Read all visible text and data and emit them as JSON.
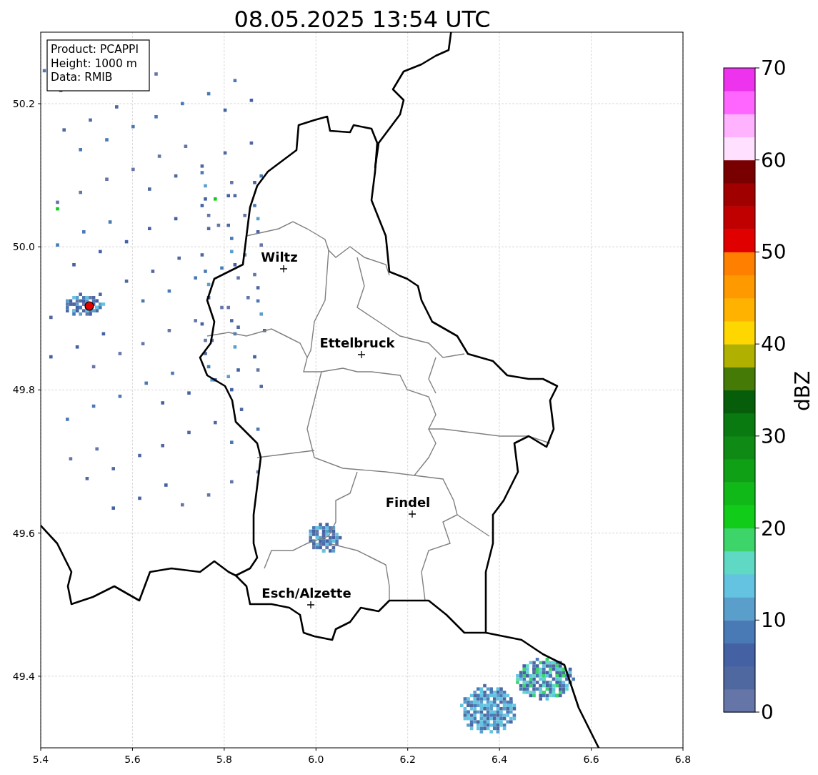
{
  "title": "08.05.2025 13:54 UTC",
  "info_box": {
    "lines": [
      "Product: PCAPPI",
      "Height: 1000 m",
      "Data: RMIB"
    ]
  },
  "map": {
    "x_ticks": [
      "5.4",
      "5.6",
      "5.8",
      "6.0",
      "6.2",
      "6.4",
      "6.6",
      "6.8"
    ],
    "y_ticks": [
      "50.2",
      "50.0",
      "49.8",
      "49.6",
      "49.4"
    ],
    "places": [
      {
        "name": "Wiltz"
      },
      {
        "name": "Ettelbruck"
      },
      {
        "name": "Findel"
      },
      {
        "name": "Esch/Alzette"
      }
    ]
  },
  "colorbar": {
    "label": "dBZ",
    "ticks": [
      "70",
      "60",
      "50",
      "40",
      "30",
      "20",
      "10",
      "0"
    ],
    "segments": [
      {
        "color": "#6575a8"
      },
      {
        "color": "#5068a0"
      },
      {
        "color": "#4361a3"
      },
      {
        "color": "#4a7ab6"
      },
      {
        "color": "#5a9fcc"
      },
      {
        "color": "#63c3e0"
      },
      {
        "color": "#5fd8c4"
      },
      {
        "color": "#3dd46a"
      },
      {
        "color": "#12cc1a"
      },
      {
        "color": "#10b818"
      },
      {
        "color": "#0fa015"
      },
      {
        "color": "#0e8a15"
      },
      {
        "color": "#097a10"
      },
      {
        "color": "#075e0a"
      },
      {
        "color": "#467a07"
      },
      {
        "color": "#b0b000"
      },
      {
        "color": "#ffd700"
      },
      {
        "color": "#ffb300"
      },
      {
        "color": "#ff9900"
      },
      {
        "color": "#ff7f00"
      },
      {
        "color": "#e00000"
      },
      {
        "color": "#c00000"
      },
      {
        "color": "#a00000"
      },
      {
        "color": "#780000"
      },
      {
        "color": "#ffe0ff"
      },
      {
        "color": "#ffb3ff"
      },
      {
        "color": "#ff66ff"
      },
      {
        "color": "#ee33ee"
      }
    ]
  }
}
